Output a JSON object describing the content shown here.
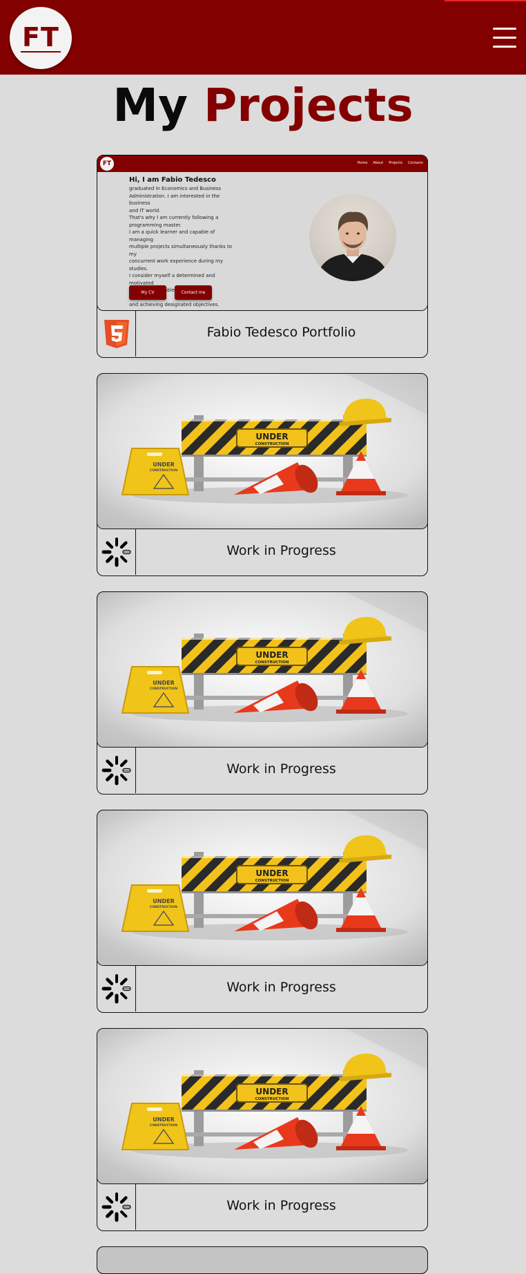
{
  "header": {
    "logo_text": "FT",
    "menu_icon": "hamburger-menu-icon",
    "background_color": "#820000"
  },
  "page": {
    "title_part1": "My",
    "title_part2": "Projects",
    "accent_color": "#820000"
  },
  "preview": {
    "logo_text": "FT",
    "nav": [
      "Home",
      "About",
      "Projects",
      "Contacts"
    ],
    "heading": "Hi, I am Fabio Tedesco",
    "body": "graduated in Economics and Business\nAdministration. I am interested in the business\nand IT world.\nThat's why I am currently following a\nprogramming master.\nI am a quick learner and capable of managing\nmultiple projects simultaneously thanks to my\nconcurrent work experience during my studies.\nI consider myself a determined and motivated\nindividual, capable of effective communication\nand achieving designated objectives.",
    "button_cv": "My CV",
    "button_contact": "Contact me"
  },
  "under_construction": {
    "sign_main": "UNDER",
    "sign_sub": "CONSTRUCTION"
  },
  "projects": [
    {
      "title": "Fabio Tedesco Portfolio",
      "icon": "html5-icon",
      "preview": "portfolio-screenshot"
    },
    {
      "title": "Work in Progress",
      "icon": "loading-spinner-icon",
      "preview": "under-construction"
    },
    {
      "title": "Work in Progress",
      "icon": "loading-spinner-icon",
      "preview": "under-construction"
    },
    {
      "title": "Work in Progress",
      "icon": "loading-spinner-icon",
      "preview": "under-construction"
    },
    {
      "title": "Work in Progress",
      "icon": "loading-spinner-icon",
      "preview": "under-construction"
    }
  ]
}
